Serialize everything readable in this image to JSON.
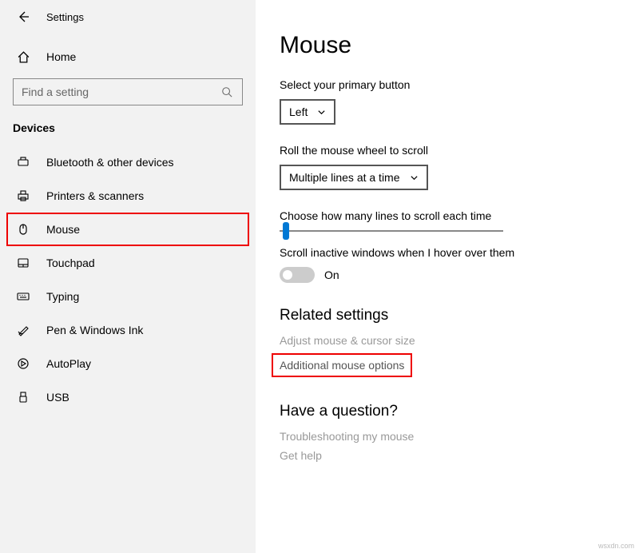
{
  "header": {
    "title": "Settings"
  },
  "home": {
    "label": "Home"
  },
  "search": {
    "placeholder": "Find a setting"
  },
  "sidebar": {
    "heading": "Devices",
    "items": [
      {
        "label": "Bluetooth & other devices"
      },
      {
        "label": "Printers & scanners"
      },
      {
        "label": "Mouse"
      },
      {
        "label": "Touchpad"
      },
      {
        "label": "Typing"
      },
      {
        "label": "Pen & Windows Ink"
      },
      {
        "label": "AutoPlay"
      },
      {
        "label": "USB"
      }
    ]
  },
  "main": {
    "title": "Mouse",
    "primary_button_label": "Select your primary button",
    "primary_button_value": "Left",
    "scroll_label": "Roll the mouse wheel to scroll",
    "scroll_value": "Multiple lines at a time",
    "lines_label": "Choose how many lines to scroll each time",
    "inactive_label": "Scroll inactive windows when I hover over them",
    "inactive_value": "On",
    "related_heading": "Related settings",
    "related_links": [
      {
        "label": "Adjust mouse & cursor size"
      },
      {
        "label": "Additional mouse options"
      }
    ],
    "question_heading": "Have a question?",
    "question_links": [
      {
        "label": "Troubleshooting my mouse"
      },
      {
        "label": "Get help"
      }
    ]
  },
  "watermark": "wsxdn.com"
}
